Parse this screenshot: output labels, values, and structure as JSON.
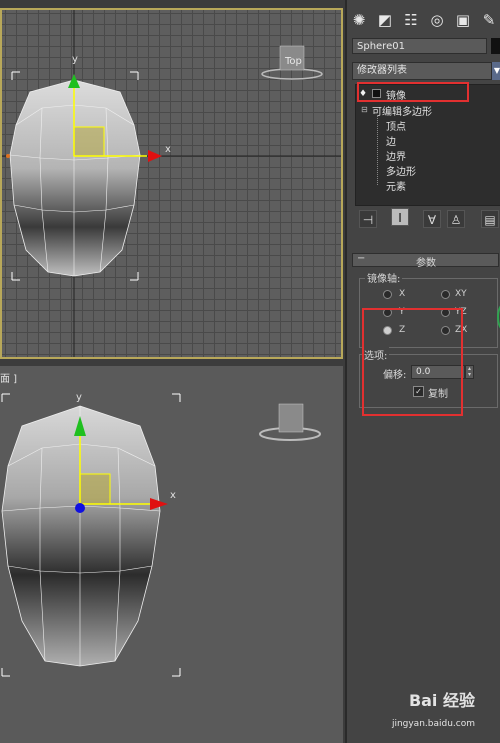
{
  "viewports": {
    "top_axis_x": "x",
    "top_axis_y": "y",
    "persp_label": "面 ]",
    "persp_axis_x": "x",
    "persp_axis_y": "y"
  },
  "panel": {
    "tabs": [
      "create-icon",
      "modify-icon",
      "hierarchy-icon",
      "motion-icon",
      "display-icon",
      "utilities-icon"
    ],
    "object_name": "Sphere01",
    "modifier_list_label": "修改器列表",
    "stack": [
      {
        "label": "镜像"
      },
      {
        "label": "可编辑多边形"
      },
      {
        "label": "顶点"
      },
      {
        "label": "边"
      },
      {
        "label": "边界"
      },
      {
        "label": "多边形"
      },
      {
        "label": "元素"
      }
    ],
    "rollout_title": "参数",
    "mirror_axis_label": "镜像轴:",
    "axes": [
      {
        "label": "X",
        "selected": false
      },
      {
        "label": "XY",
        "selected": false
      },
      {
        "label": "Y",
        "selected": false
      },
      {
        "label": "YZ",
        "selected": false
      },
      {
        "label": "Z",
        "selected": true
      },
      {
        "label": "ZX",
        "selected": false
      }
    ],
    "options_label": "选项:",
    "offset_label": "偏移:",
    "offset_value": "0.0",
    "copy_label": "复制",
    "copy_checked": true
  },
  "watermark": {
    "brand": "Bai 经验",
    "url": "jingyan.baidu.com"
  },
  "colors": {
    "highlight": "#e23030",
    "viewport_border": "#b8a85a"
  }
}
